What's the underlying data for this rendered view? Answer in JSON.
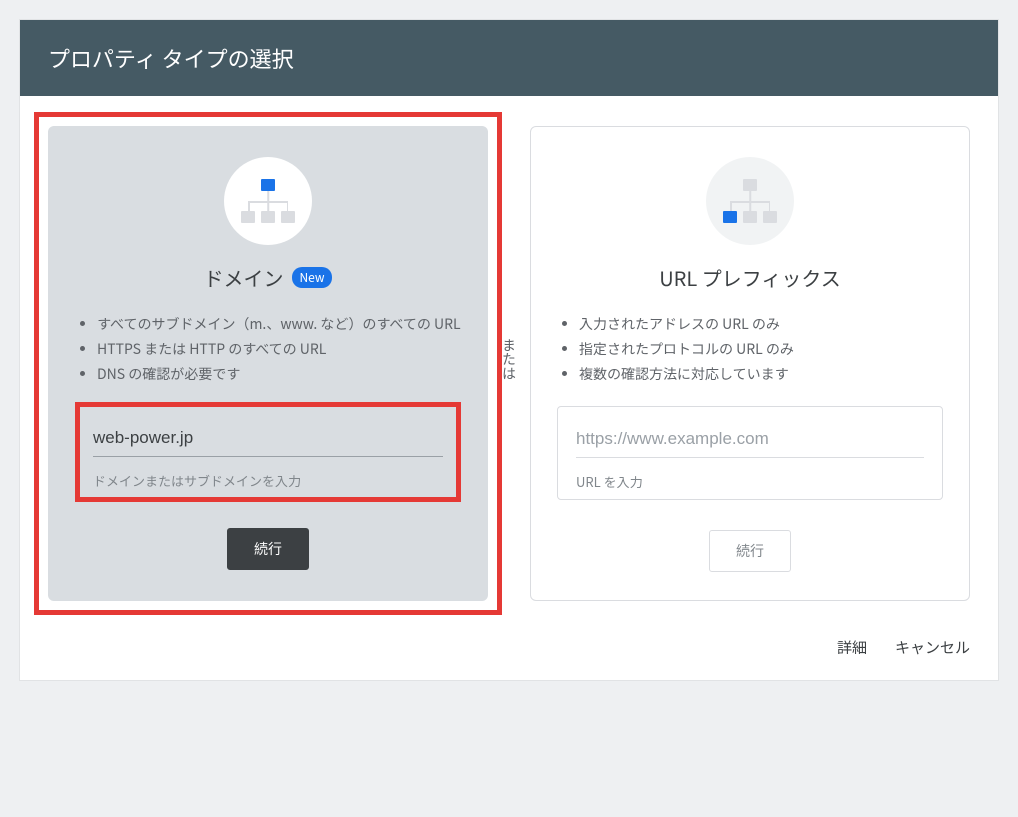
{
  "header": {
    "title": "プロパティ タイプの選択"
  },
  "separator": "または",
  "domain_card": {
    "title": "ドメイン",
    "badge": "New",
    "bullets": [
      "すべてのサブドメイン（m.、www. など）のすべての URL",
      "HTTPS または HTTP のすべての URL",
      "DNS の確認が必要です"
    ],
    "input_value": "web-power.jp",
    "input_helper": "ドメインまたはサブドメインを入力",
    "button": "続行"
  },
  "url_card": {
    "title": "URL プレフィックス",
    "bullets": [
      "入力されたアドレスの URL のみ",
      "指定されたプロトコルの URL のみ",
      "複数の確認方法に対応しています"
    ],
    "input_placeholder": "https://www.example.com",
    "input_helper": "URL を入力",
    "button": "続行"
  },
  "footer": {
    "detail": "詳細",
    "cancel": "キャンセル"
  }
}
